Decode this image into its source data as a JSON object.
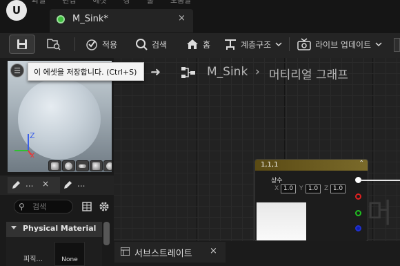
{
  "menu": [
    "파일",
    "편집",
    "에셋",
    "창",
    "툴",
    "도움말"
  ],
  "tab": {
    "title": "M_Sink*",
    "close": "×"
  },
  "toolbar": {
    "apply_label": "적용",
    "search_label": "검색",
    "home_label": "홈",
    "hierarchy_label": "계층구조",
    "live_update_label": "라이브 업데이트"
  },
  "tooltip": "이 에셋을 저장합니다. (Ctrl+S)",
  "breadcrumb": {
    "asset": "M_Sink",
    "graph": "머티리얼 그래프"
  },
  "node": {
    "title": "1,1,1",
    "label": "상수",
    "x_label": "X",
    "x_value": "1.0",
    "y_label": "Y",
    "y_value": "1.0",
    "z_label": "Z",
    "z_value": "1.0"
  },
  "graph_ghost_text": "머",
  "left_tabs": {
    "tab1": "...",
    "tab2": "..."
  },
  "search": {
    "placeholder": "검색"
  },
  "details": {
    "section": "Physical Material",
    "prop_label": "피직...",
    "prop_value": "None"
  },
  "bottom_tab": {
    "label": "서브스트레이트",
    "close": "×"
  },
  "gizmo": {
    "z": "Z",
    "x": "X"
  },
  "colors": {
    "accent_green": "#3fbf3f",
    "node_header": "#7a6a2a",
    "tooltip_bg": "#f4f4f4"
  }
}
